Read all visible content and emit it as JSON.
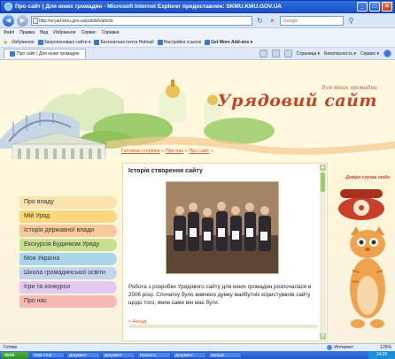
{
  "window": {
    "title": "Про сайт | Для юних громадян - Microsoft Internet Explorer предоставлен: SKMU.KMU.GOV.UA",
    "minimize": "_",
    "maximize": "□",
    "close": "×"
  },
  "address": {
    "url": "http://uryad.kmu.gov.ua/publish/article",
    "search_placeholder": "Google",
    "back": "◀",
    "forward": "▶",
    "refresh": "↻",
    "stop": "×"
  },
  "menu": [
    "Файл",
    "Правка",
    "Вид",
    "Избранное",
    "Сервис",
    "Справка"
  ],
  "favorites": {
    "label": "Избранное",
    "items": [
      "Запропоновані сайти ▾",
      "Бесплатная почта Hotmail",
      "Настройка ссылок",
      "Get More Add-ons ▾"
    ]
  },
  "tab": {
    "label": "Про сайт | Для юних громадян"
  },
  "commands": [
    "Страница ▾",
    "Безопасность ▾",
    "Сервис ▾"
  ],
  "brand": {
    "small": "для юних громадян",
    "big": "Урядовий сайт"
  },
  "breadcrumbs": {
    "home": "Головна сторінка",
    "sep1": "»",
    "about": "Про нас",
    "sep2": "»",
    "site": "Про сайт",
    "sep3": "»"
  },
  "sidebar": {
    "items": [
      {
        "label": "Про владу",
        "color": "#fbe3b0"
      },
      {
        "label": "Мій Уряд",
        "color": "#f9d77c"
      },
      {
        "label": "Історія державної влади",
        "color": "#f6c99a"
      },
      {
        "label": "Екскурсія Будинком Уряду",
        "color": "#c9df8f"
      },
      {
        "label": "Моя Україна",
        "color": "#a9d6ea"
      },
      {
        "label": "Школа громадянської освіти",
        "color": "#c4d4f0"
      },
      {
        "label": "Ігри та конкурси",
        "color": "#e3c9ef"
      },
      {
        "label": "Про нас",
        "color": "#f6b9b4"
      }
    ]
  },
  "article": {
    "title": "Історія створення сайту",
    "text": "Робота з розробки Урядового сайту для юних громадян розпочалася в 2006 році. Спочатку було вивчено думку майбутніх користувачів сайту щодо того, яким саме він має бути.",
    "more": "» Назад"
  },
  "phone": {
    "label": "Довіра слухає тебе"
  },
  "status": {
    "text": "Готово",
    "zone": "Интернет",
    "zoom": "125%"
  },
  "taskbar": {
    "start": "пуск",
    "tasks": [
      "Total Cmd",
      "Документ",
      "Документ",
      "Проекты",
      "Документ",
      "Sample"
    ],
    "clock": "14:26"
  },
  "colors": {
    "accent": "#c2452a",
    "link": "#d35b2f",
    "xp_blue": "#2456c8"
  }
}
